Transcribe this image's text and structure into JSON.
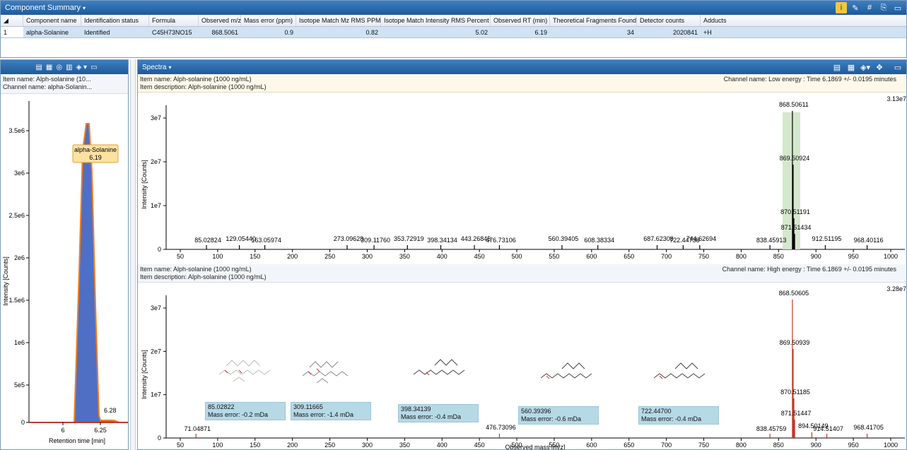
{
  "summary": {
    "title": "Component Summary",
    "columns": [
      "Component name",
      "Identification status",
      "Formula",
      "Observed m/z",
      "Mass error (ppm)",
      "Isotope Match Mz RMS PPM",
      "Isotope Match Intensity RMS Percent",
      "Observed RT (min)",
      "Theoretical Fragments Found",
      "Detector counts",
      "Adducts"
    ],
    "row": {
      "index": "1",
      "name": "alpha-Solanine",
      "status": "Identified",
      "formula": "C45H73NO15",
      "mz": "868.5061",
      "mass_error": "0.9",
      "iso_mz": "0.82",
      "iso_int": "5.02",
      "rt": "6.19",
      "frags": "34",
      "counts": "2020841",
      "adducts": "+H"
    }
  },
  "chromatogram": {
    "item": "Item name: Alph-solanine (10...",
    "channel": "Channel name: alpha-Solanin...",
    "ylabel": "Intensity [Counts]",
    "xlabel": "Retention time [min]",
    "peak_label_1": "alpha-Solanine",
    "peak_label_2": "6.19",
    "side_peak": "6.28",
    "yticks": [
      "3.5e6",
      "3e6",
      "2.5e6",
      "2e6",
      "1.5e6",
      "1e6",
      "5e5",
      "0"
    ],
    "xticks": [
      "6",
      "6.25"
    ]
  },
  "spectra": {
    "title": "Spectra",
    "low": {
      "item": "Item name: Alph-solanine (1000 ng/mL)",
      "desc": "Item description: Alph-solanine (1000 ng/mL)",
      "channel": "Channel name: Low energy : Time 6.1869 +/- 0.0195 minutes",
      "max": "3.13e7",
      "ylabel": "Intensity [Counts]",
      "yticks": [
        "3e7",
        "2e7",
        "1e7",
        "0"
      ],
      "peaks": [
        "85.02824",
        "129.05440",
        "163.05974",
        "273.09628",
        "309.11760",
        "353.72919",
        "398.34134",
        "443.26845",
        "476.73106",
        "560.39405",
        "608.38334",
        "687.62308",
        "722.44738",
        "744.62694",
        "838.45913",
        "868.50611",
        "869.50924",
        "870.51191",
        "871.51434",
        "912.51195",
        "968.40116"
      ]
    },
    "high": {
      "item": "Item name: Alph-solanine (1000 ng/mL)",
      "desc": "Item description: Alph-solanine (1000 ng/mL)",
      "channel": "Channel name: High energy : Time 6.1869 +/- 0.0195 minutes",
      "max": "3.28e7",
      "ylabel": "Intensity [Counts]",
      "yticks": [
        "3e7",
        "2e7",
        "1e7",
        "0"
      ],
      "xlabel": "Observed mass [m/z]",
      "peaks": [
        "71.04871",
        "476.73096",
        "838.45759",
        "868.50605",
        "869.50939",
        "870.51185",
        "871.51447",
        "894.50149",
        "914.51407",
        "968.41705"
      ],
      "fragments": [
        {
          "mz": "85.02822",
          "err": "Mass error: -0.2 mDa"
        },
        {
          "mz": "309.11665",
          "err": "Mass error: -1.4 mDa"
        },
        {
          "mz": "398.34139",
          "err": "Mass error: -0.4 mDa"
        },
        {
          "mz": "560.39396",
          "err": "Mass error: -0.6 mDa"
        },
        {
          "mz": "722.44700",
          "err": "Mass error: -0.4 mDa"
        }
      ]
    },
    "xticks": [
      "50",
      "100",
      "150",
      "200",
      "250",
      "300",
      "350",
      "400",
      "450",
      "500",
      "550",
      "600",
      "650",
      "700",
      "750",
      "800",
      "850",
      "900",
      "950",
      "1000"
    ]
  }
}
